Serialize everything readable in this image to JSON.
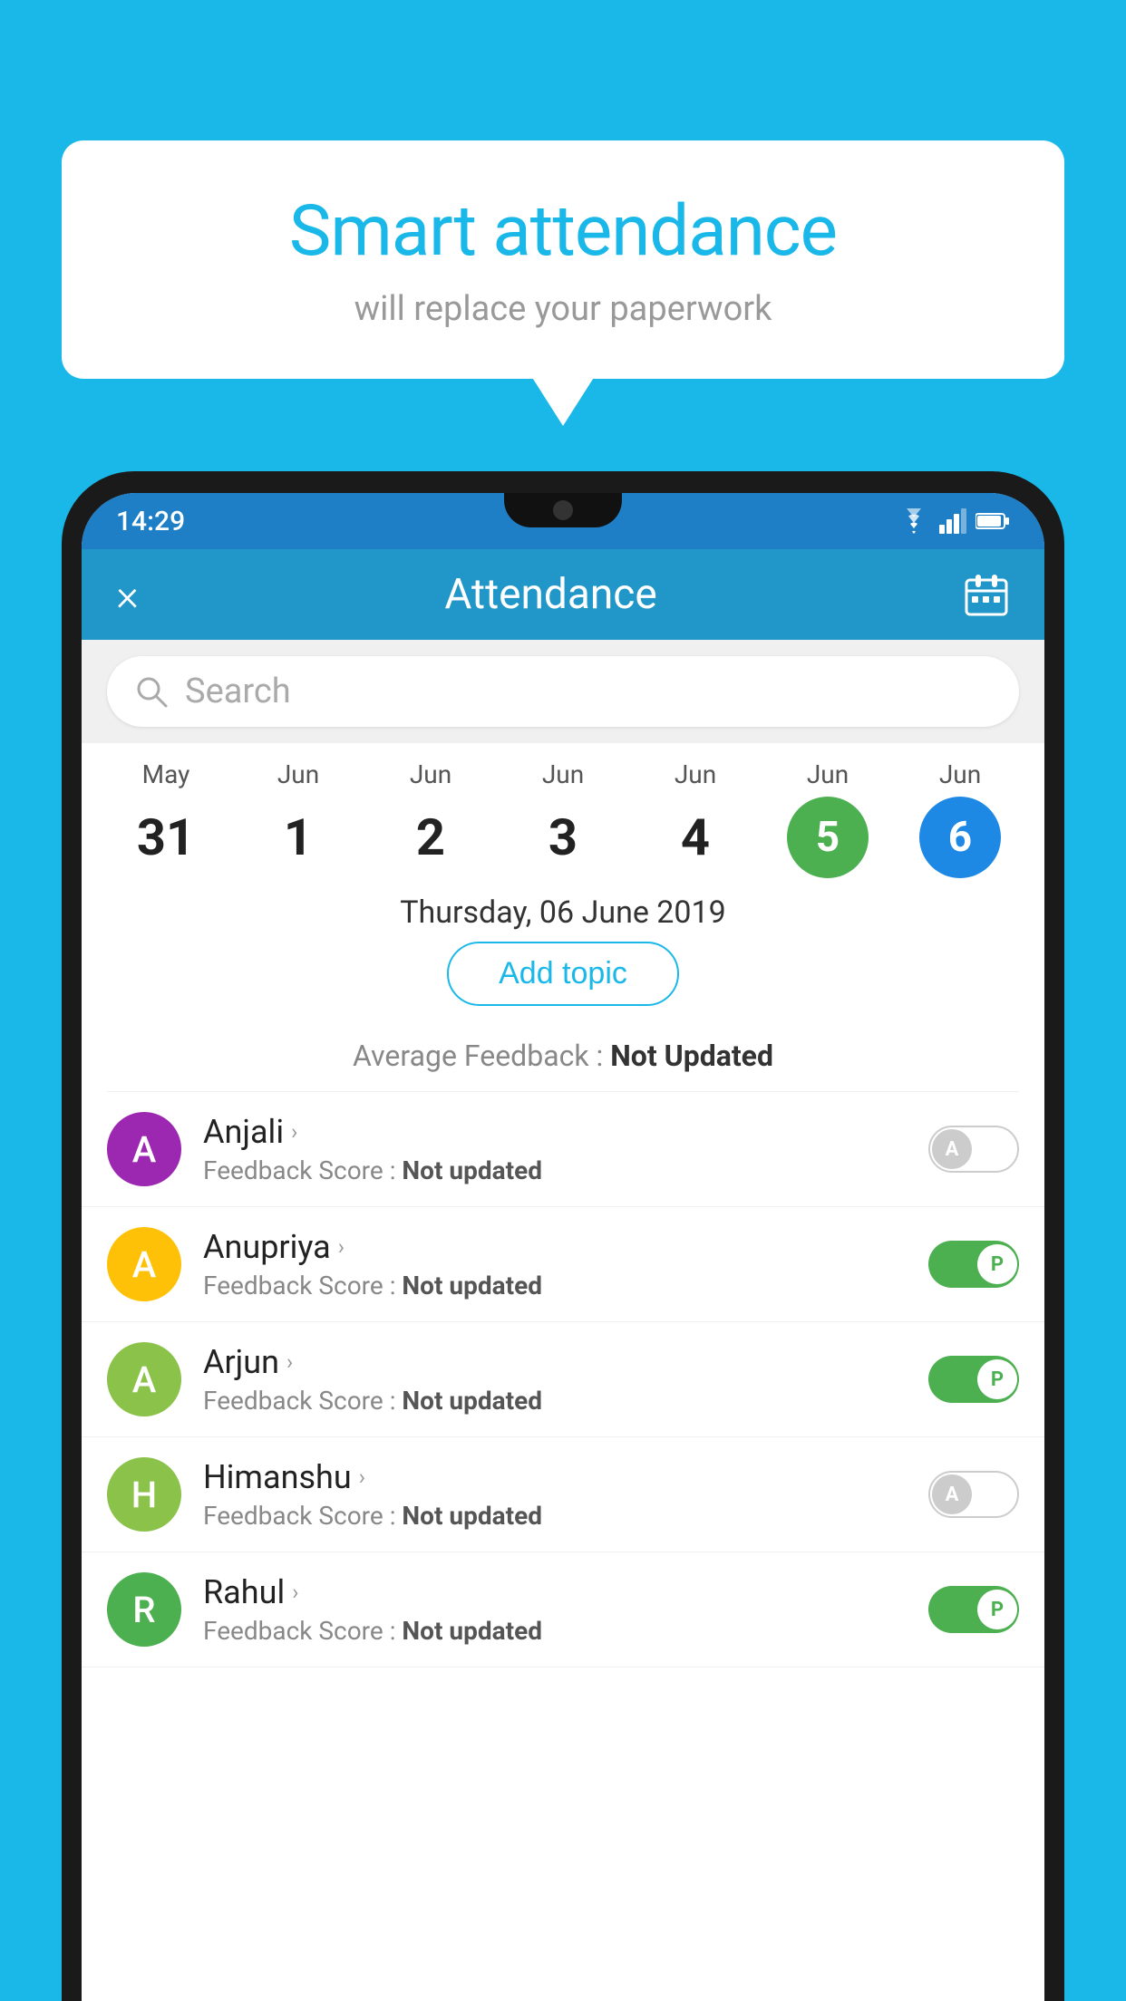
{
  "background_color": "#1ab8e8",
  "bubble": {
    "title": "Smart attendance",
    "subtitle": "will replace your paperwork"
  },
  "status_bar": {
    "time": "14:29",
    "icons": [
      "wifi",
      "signal",
      "battery"
    ]
  },
  "app_bar": {
    "title": "Attendance",
    "close_label": "×",
    "calendar_icon": "📅"
  },
  "search": {
    "placeholder": "Search"
  },
  "dates": [
    {
      "month": "May",
      "day": "31",
      "style": "normal"
    },
    {
      "month": "Jun",
      "day": "1",
      "style": "normal"
    },
    {
      "month": "Jun",
      "day": "2",
      "style": "normal"
    },
    {
      "month": "Jun",
      "day": "3",
      "style": "normal"
    },
    {
      "month": "Jun",
      "day": "4",
      "style": "normal"
    },
    {
      "month": "Jun",
      "day": "5",
      "style": "green"
    },
    {
      "month": "Jun",
      "day": "6",
      "style": "blue"
    }
  ],
  "selected_date": "Thursday, 06 June 2019",
  "add_topic_label": "Add topic",
  "avg_feedback_label": "Average Feedback : ",
  "avg_feedback_value": "Not Updated",
  "students": [
    {
      "name": "Anjali",
      "avatar_letter": "A",
      "avatar_color": "#9c27b0",
      "feedback_label": "Feedback Score : ",
      "feedback_value": "Not updated",
      "toggle": "off",
      "toggle_letter": "A"
    },
    {
      "name": "Anupriya",
      "avatar_letter": "A",
      "avatar_color": "#ffc107",
      "feedback_label": "Feedback Score : ",
      "feedback_value": "Not updated",
      "toggle": "on",
      "toggle_letter": "P"
    },
    {
      "name": "Arjun",
      "avatar_letter": "A",
      "avatar_color": "#8bc34a",
      "feedback_label": "Feedback Score : ",
      "feedback_value": "Not updated",
      "toggle": "on",
      "toggle_letter": "P"
    },
    {
      "name": "Himanshu",
      "avatar_letter": "H",
      "avatar_color": "#8bc34a",
      "feedback_label": "Feedback Score : ",
      "feedback_value": "Not updated",
      "toggle": "off",
      "toggle_letter": "A"
    },
    {
      "name": "Rahul",
      "avatar_letter": "R",
      "avatar_color": "#4caf50",
      "feedback_label": "Feedback Score : ",
      "feedback_value": "Not updated",
      "toggle": "on",
      "toggle_letter": "P"
    }
  ]
}
